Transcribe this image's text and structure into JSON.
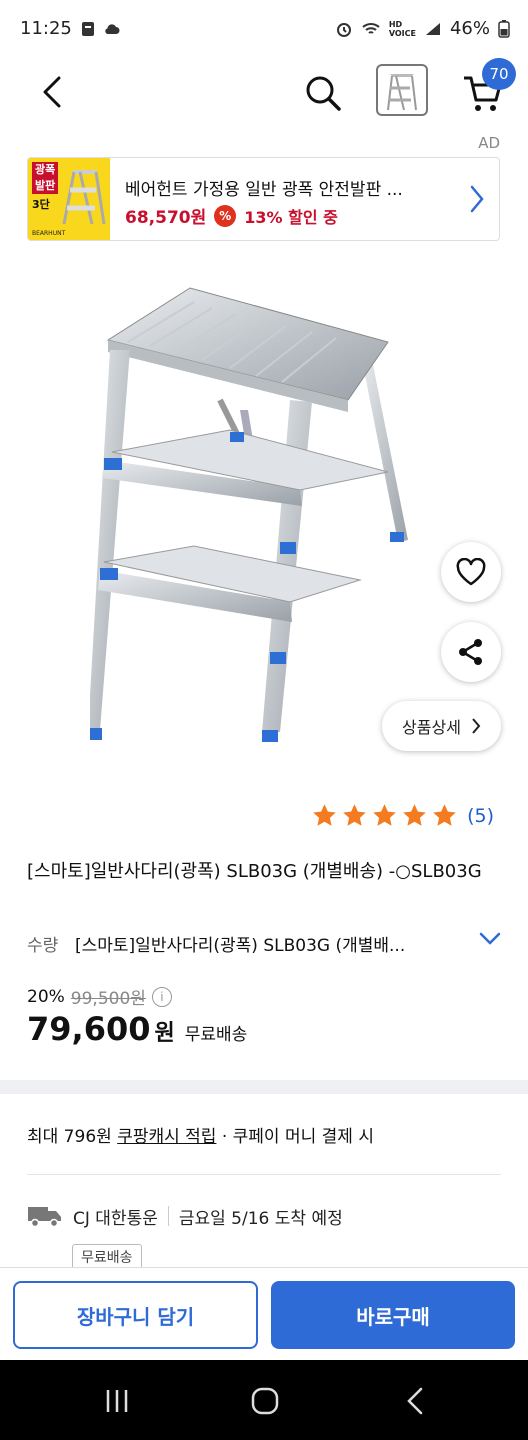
{
  "status_bar": {
    "time": "11:25",
    "battery": "46%",
    "network_label_top": "HD",
    "network_label_bottom": "VOICE"
  },
  "header": {
    "cart_count": "70"
  },
  "ad": {
    "label": "AD",
    "thumb_badge": "광폭",
    "thumb_line2": "발판",
    "thumb_line3": "3단",
    "thumb_brand": "BEARHUNT",
    "title": "베어헌트 가정용 일반 광폭 안전발판 ...",
    "price": "68,570원",
    "discount_icon": "%",
    "discount": "13% 할인 중"
  },
  "product": {
    "detail_button": "상품상세",
    "rating_value": 5,
    "rating_count": "(5)",
    "title": "[스마토]일반사다리(광폭) SLB03G (개별배송) -○SLB03G",
    "option_label": "수량",
    "option_value": "[스마토]일반사다리(광폭) SLB03G (개별배...",
    "discount_rate": "20%",
    "original_price": "99,500원",
    "info_icon": "i",
    "sale_price": "79,600",
    "sale_currency": "원",
    "shipping": "무료배송"
  },
  "cash": {
    "prefix": "최대 796원 ",
    "link": "쿠팡캐시 적립",
    "suffix": " · 쿠페이 머니 결제 시"
  },
  "delivery": {
    "carrier": "CJ 대한통운",
    "eta": "금요일 5/16 도착 예정",
    "tag": "무료배송"
  },
  "bottom_bar": {
    "cart_button": "장바구니 담기",
    "buy_button": "바로구매"
  },
  "colors": {
    "accent": "#2f6bd6",
    "price_red": "#c8102e",
    "star": "#f47b20",
    "rating_link": "#1c5fce"
  }
}
